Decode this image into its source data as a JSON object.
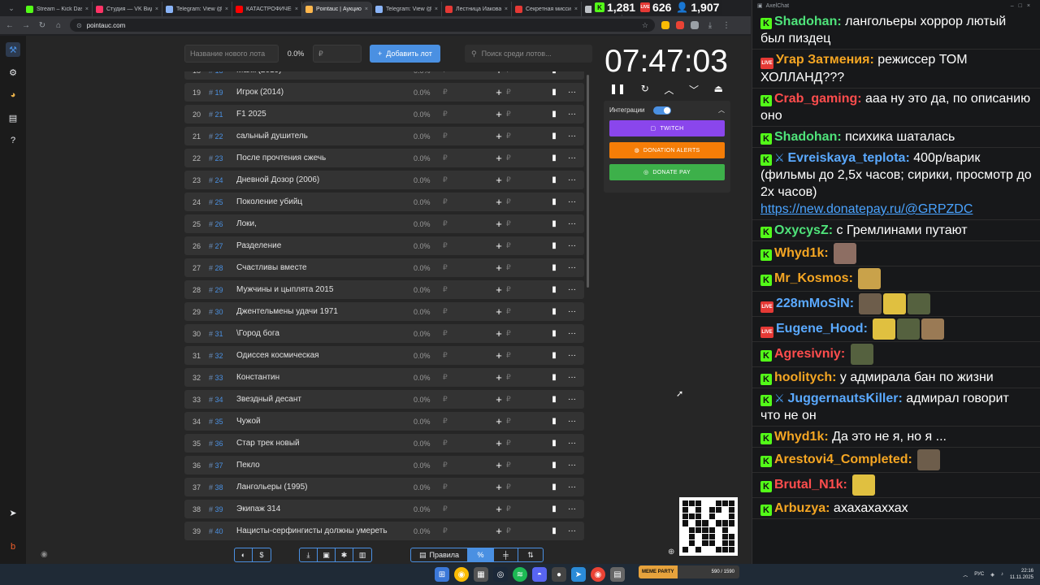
{
  "browser": {
    "tabs": [
      {
        "label": "Stream – Kick Dashb",
        "color": "#53fc18"
      },
      {
        "label": "Студия — VK Видео",
        "color": "#ff3366"
      },
      {
        "label": "Telegram: View @d",
        "color": "#8ab4f8"
      },
      {
        "label": "КАТАСТРОФИЧЕСКИ",
        "color": "#ff0000"
      },
      {
        "label": "Pointauc | Аукцион",
        "color": "#ffb74d",
        "active": true
      },
      {
        "label": "Telegram: View @n",
        "color": "#8ab4f8"
      },
      {
        "label": "Лестница Иакова (",
        "color": "#e53935"
      },
      {
        "label": "Секретная миссия",
        "color": "#e53935"
      },
      {
        "label": "The",
        "color": "#bdc1c6"
      }
    ],
    "url": "pointauc.com"
  },
  "stream_stats": {
    "kick": "1,281",
    "vk": "626",
    "viewers": "1,907"
  },
  "controls": {
    "lot_name_placeholder": "Название нового лота",
    "percent": "0.0%",
    "amount_placeholder": "₽",
    "add_button": "Добавить лот",
    "search_placeholder": "Поиск среди лотов..."
  },
  "lots": [
    {
      "n": "18",
      "id": "18",
      "name": "Маяк (2019)"
    },
    {
      "n": "19",
      "id": "19",
      "name": "Игрок (2014)"
    },
    {
      "n": "20",
      "id": "21",
      "name": "F1 2025"
    },
    {
      "n": "21",
      "id": "22",
      "name": "сальный душитель"
    },
    {
      "n": "22",
      "id": "23",
      "name": "После прочтения сжечь"
    },
    {
      "n": "23",
      "id": "24",
      "name": "Дневной Дозор (2006)"
    },
    {
      "n": "24",
      "id": "25",
      "name": "Поколение убийц"
    },
    {
      "n": "25",
      "id": "26",
      "name": "Локи,"
    },
    {
      "n": "26",
      "id": "27",
      "name": "Разделение"
    },
    {
      "n": "27",
      "id": "28",
      "name": "Счастливы вместе"
    },
    {
      "n": "28",
      "id": "29",
      "name": "Мужчины и цыплята 2015"
    },
    {
      "n": "29",
      "id": "30",
      "name": "Джентельмены удачи 1971"
    },
    {
      "n": "30",
      "id": "31",
      "name": "\\Город бога"
    },
    {
      "n": "31",
      "id": "32",
      "name": "Одиссея космическая"
    },
    {
      "n": "32",
      "id": "33",
      "name": "Константин"
    },
    {
      "n": "33",
      "id": "34",
      "name": "Звездный десант"
    },
    {
      "n": "34",
      "id": "35",
      "name": "Чужой"
    },
    {
      "n": "35",
      "id": "36",
      "name": "Стар трек новый"
    },
    {
      "n": "36",
      "id": "37",
      "name": "Пекло"
    },
    {
      "n": "37",
      "id": "38",
      "name": "Лангольеры (1995)"
    },
    {
      "n": "38",
      "id": "39",
      "name": "Экипаж 314"
    },
    {
      "n": "39",
      "id": "40",
      "name": "Нацисты-серфингисты должны умереть"
    }
  ],
  "row_percent": "0.0%",
  "row_currency": "₽",
  "timer": "07:47:03",
  "integrations": {
    "label": "Интеграции",
    "twitch": "TWITCH",
    "donation_alerts": "DONATION ALERTS",
    "donate_pay": "DONATE PAY",
    "colors": {
      "twitch": "#8a46ec",
      "donation_alerts": "#f57d07",
      "donate_pay": "#3db04a"
    }
  },
  "bottom": {
    "rules": "Правила"
  },
  "chat": {
    "title": "AxelChat",
    "messages": [
      {
        "platform": "k",
        "user": "Shadohan",
        "color": "#4fe37a",
        "text": "лангольеры хоррор лютый был пиздец"
      },
      {
        "platform": "live",
        "user": "Угар Затмения",
        "color": "#f5a623",
        "text": "режиссер ТОМ ХОЛЛАНД???"
      },
      {
        "platform": "k",
        "user": "Crab_gaming",
        "color": "#ff4d4d",
        "text": "ааа ну это да, по описанию оно"
      },
      {
        "platform": "k",
        "user": "Shadohan",
        "color": "#4fe37a",
        "text": "психика шаталась"
      },
      {
        "platform": "k",
        "user": "Evreiskaya_teplota",
        "color": "#5aa9ff",
        "badge": true,
        "text": "400р/варик (фильмы до 2,5х часов; сирики, просмотр до 2х часов)",
        "link": "https://new.donatepay.ru/@GRPZDC"
      },
      {
        "platform": "k",
        "user": "OxycysZ",
        "color": "#4fe37a",
        "text": "с Гремлинами путают"
      },
      {
        "platform": "k",
        "user": "Whyd1k",
        "color": "#f5a623",
        "text": ""
      },
      {
        "platform": "k",
        "user": "Mr_Kosmos",
        "color": "#f5a623",
        "text": ""
      },
      {
        "platform": "live",
        "user": "228mMoSiN",
        "color": "#5aa9ff",
        "text": ""
      },
      {
        "platform": "live",
        "user": "Eugene_Hood",
        "color": "#5aa9ff",
        "text": ""
      },
      {
        "platform": "k",
        "user": "Agresivniy",
        "color": "#ff4d4d",
        "text": ""
      },
      {
        "platform": "k",
        "user": "hoolitych",
        "color": "#f5a623",
        "text": "у адмирала бан по жизни"
      },
      {
        "platform": "k",
        "user": "JuggernautsKiller",
        "color": "#5aa9ff",
        "badge": true,
        "text": "адмирал говорит что не он"
      },
      {
        "platform": "k",
        "user": "Whyd1k",
        "color": "#f5a623",
        "text": "Да это не я, но я ..."
      },
      {
        "platform": "k",
        "user": "Arestovi4_Completed",
        "color": "#f5a623",
        "text": ""
      },
      {
        "platform": "k",
        "user": "Brutal_N1k",
        "color": "#ff4d4d",
        "text": ""
      },
      {
        "platform": "k",
        "user": "Arbuzya",
        "color": "#f5a623",
        "text": "ахахахаххах"
      }
    ]
  },
  "taskbar": {
    "memes_label": "MEME PARTY",
    "memes_count": "590 / 1590",
    "lang": "РУС",
    "time": "22:16",
    "date": "11.11.2025"
  }
}
